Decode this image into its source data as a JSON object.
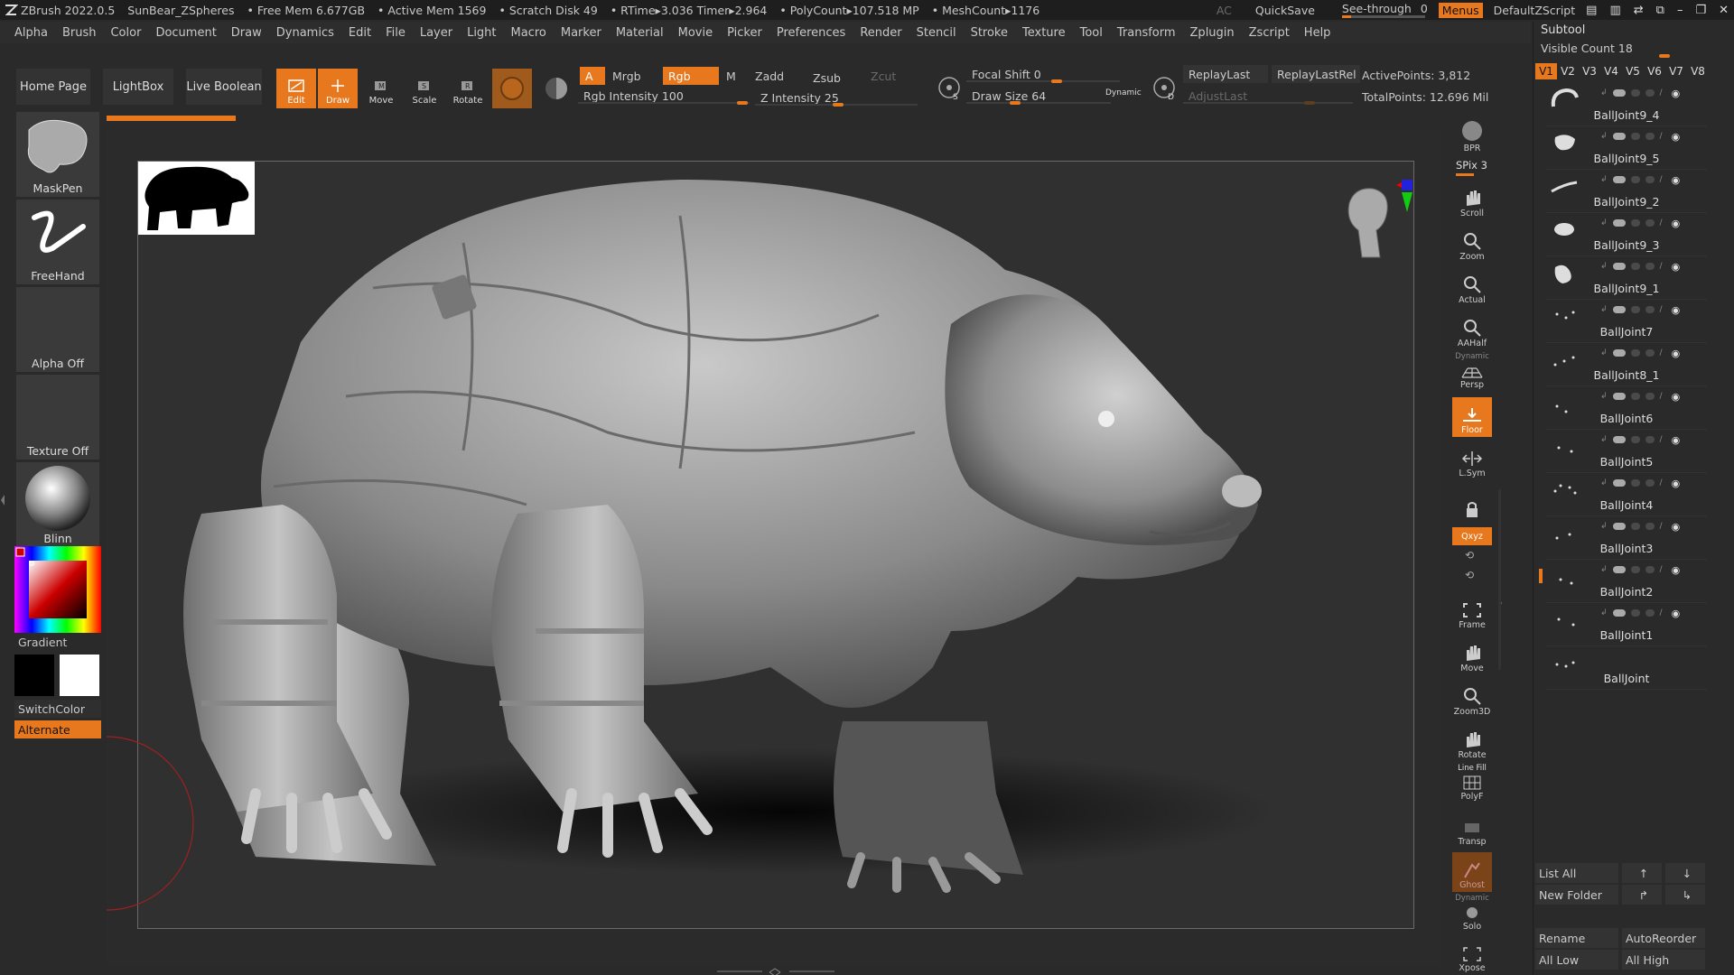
{
  "titlebar": {
    "app": "ZBrush 2022.0.5",
    "project": "SunBear_ZSpheres",
    "free_mem": "• Free Mem 6.677GB",
    "active_mem": "• Active Mem 1569",
    "scratch": "• Scratch Disk 49",
    "rtime": "• RTime▸3.036 Timer▸2.964",
    "polycount": "• PolyCount▸107.518 MP",
    "meshcount": "• MeshCount▸1176",
    "ac": "AC",
    "quicksave": "QuickSave",
    "see_through": "See-through",
    "see_through_value": "0",
    "menus": "Menus",
    "zscript": "DefaultZScript"
  },
  "menubar": [
    "Alpha",
    "Brush",
    "Color",
    "Document",
    "Draw",
    "Dynamics",
    "Edit",
    "File",
    "Layer",
    "Light",
    "Macro",
    "Marker",
    "Material",
    "Movie",
    "Picker",
    "Preferences",
    "Render",
    "Stencil",
    "Stroke",
    "Texture",
    "Tool",
    "Transform",
    "Zplugin",
    "Zscript",
    "Help"
  ],
  "tabs": {
    "home": "Home Page",
    "lightbox": "LightBox",
    "live_boolean": "Live Boolean"
  },
  "tools": {
    "edit": "Edit",
    "draw": "Draw",
    "move": "Move",
    "scale": "Scale",
    "rotate": "Rotate"
  },
  "options": {
    "a": "A",
    "mrgb": "Mrgb",
    "rgb": "Rgb",
    "m": "M",
    "zadd": "Zadd",
    "zsub": "Zsub",
    "zcut": "Zcut",
    "rgb_intensity": "Rgb Intensity 100",
    "z_intensity": "Z Intensity 25",
    "focal_shift": "Focal Shift 0",
    "draw_size": "Draw Size 64",
    "dynamic": "Dynamic",
    "replay_last": "ReplayLast",
    "replay_last_rel": "ReplayLastRel",
    "adjust_last": "AdjustLast",
    "active_points": "ActivePoints: 3,812",
    "total_points": "TotalPoints: 12.696 Mil"
  },
  "left_panel": {
    "brush": "MaskPen",
    "stroke": "FreeHand",
    "alpha": "Alpha Off",
    "texture": "Texture Off",
    "material": "Blinn",
    "gradient": "Gradient",
    "switch_color": "SwitchColor",
    "alternate": "Alternate"
  },
  "right_shelf": {
    "bpr": "BPR",
    "spix": "SPix 3",
    "scroll": "Scroll",
    "zoom": "Zoom",
    "actual": "Actual",
    "aahalf": "AAHalf",
    "dynamic": "Dynamic",
    "persp": "Persp",
    "floor": "Floor",
    "lsym": "L.Sym",
    "xyz": "Qxyz",
    "frame": "Frame",
    "move": "Move",
    "zoom3d": "Zoom3D",
    "rotate": "Rotate",
    "line_fill": "Line Fill",
    "polyf": "PolyF",
    "transp": "Transp",
    "ghost": "Ghost",
    "dynamic2": "Dynamic",
    "solo": "Solo",
    "xpose": "Xpose"
  },
  "subtool": {
    "title": "Subtool",
    "visible_count": "Visible Count 18",
    "versions": [
      "V1",
      "V2",
      "V3",
      "V4",
      "V5",
      "V6",
      "V7",
      "V8"
    ],
    "items": [
      "BallJoint9_4",
      "BallJoint9_5",
      "BallJoint9_2",
      "BallJoint9_3",
      "BallJoint9_1",
      "BallJoint7",
      "BallJoint8_1",
      "BallJoint6",
      "BallJoint5",
      "BallJoint4",
      "BallJoint3",
      "BallJoint2",
      "BallJoint1",
      "BallJoint"
    ],
    "list_all": "List All",
    "new_folder": "New Folder",
    "rename": "Rename",
    "auto_reorder": "AutoReorder",
    "all_low": "All Low",
    "all_high": "All High"
  },
  "colors": {
    "accent": "#e8781e",
    "bg": "#2a2a2a"
  }
}
